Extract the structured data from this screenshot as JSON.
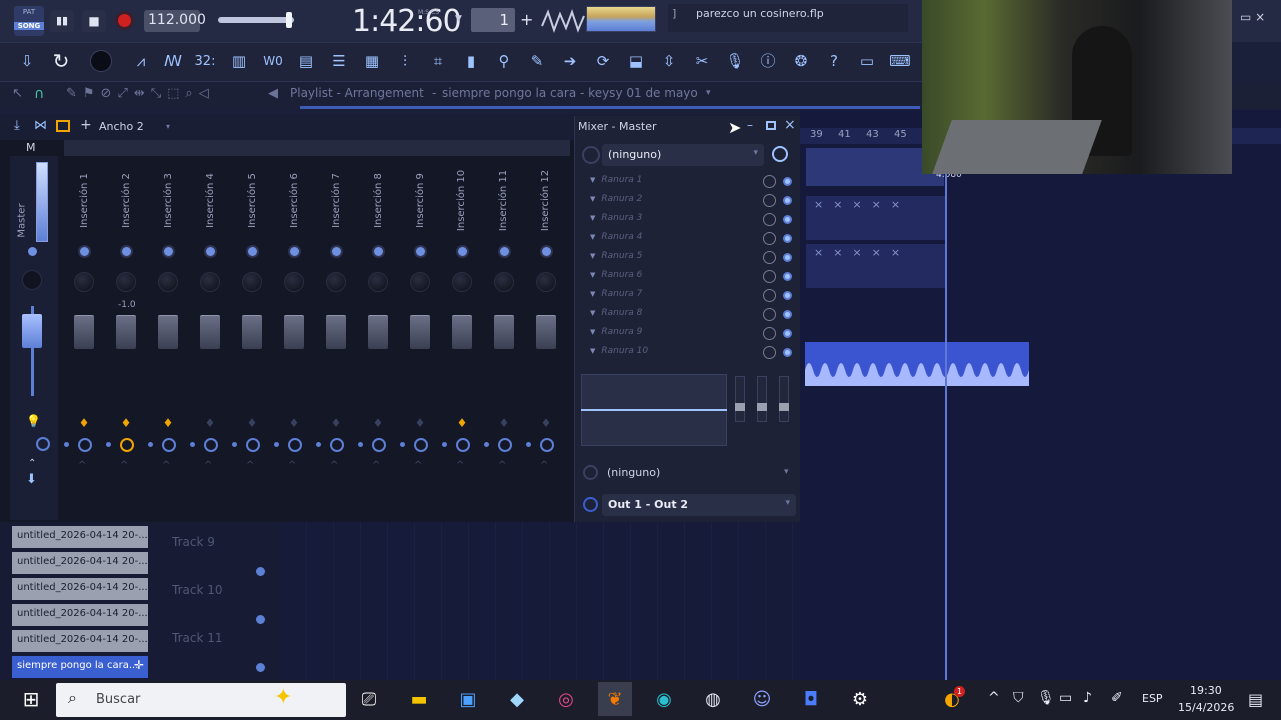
{
  "app": {
    "logo_top": "PAT",
    "logo_bottom": "SONG",
    "tempo": "112.000",
    "time": "1:42:60",
    "time_unit": "M:S:CS",
    "pattern": "1",
    "hint": "parezco un cosinero.flp",
    "colors": {
      "accent": "#5d7fd6",
      "orange": "#f0a500",
      "red": "#d02020"
    }
  },
  "toolbar_icons": [
    "download-icon",
    "refresh-icon",
    "cpu-icon",
    "waveform-icon",
    "tempo-icon",
    "32-icon",
    "grid-icon",
    "mixer-icon",
    "playlist-icon",
    "stack-icon",
    "piano-icon",
    "mixer-sliders-icon",
    "pattern-icon",
    "clipboard-icon",
    "plug-icon",
    "pencil-icon",
    "arrow-icon",
    "loop-icon",
    "save-icon",
    "split-icon",
    "scissors-icon",
    "mic-icon",
    "info-icon",
    "help-icon",
    "question-icon",
    "layout-icon",
    "keyboard-icon"
  ],
  "playlist": {
    "title": "Playlist - Arrangement",
    "subtitle": "siempre pongo la cara - keysy 01 de mayo",
    "ruler": [
      "39",
      "41",
      "43",
      "45"
    ],
    "clip_label": "4.080"
  },
  "mixer_toolbar": {
    "width_label": "Ancho 2"
  },
  "mixer": {
    "title": "Mixer - Master",
    "master_label": "Master",
    "m_label": "M",
    "inserts": [
      "Inserción 1",
      "Inserción 2",
      "Inserción 3",
      "Inserción 4",
      "Inserción 5",
      "Inserción 6",
      "Inserción 7",
      "Inserción 8",
      "Inserción 9",
      "Inserción 10",
      "Inserción 11",
      "Inserción 12"
    ],
    "insert2_value": "-1.0",
    "active_inserts": [
      1,
      2,
      3,
      10
    ]
  },
  "mixer_panel": {
    "preset": "(ninguno)",
    "slots": [
      "Ranura 1",
      "Ranura 2",
      "Ranura 3",
      "Ranura 4",
      "Ranura 5",
      "Ranura 6",
      "Ranura 7",
      "Ranura 8",
      "Ranura 9",
      "Ranura 10"
    ],
    "input": "(ninguno)",
    "output": "Out 1 - Out 2"
  },
  "browser": {
    "files": [
      "untitled_2026-04-14 20-...",
      "untitled_2026-04-14 20-...",
      "untitled_2026-04-14 20-...",
      "untitled_2026-04-14 20-...",
      "untitled_2026-04-14 20-..."
    ],
    "selected_file": "siempre pongo la cara..."
  },
  "tracks": [
    "Track 9",
    "Track 10",
    "Track 11"
  ],
  "taskbar": {
    "search_placeholder": "Buscar",
    "lang": "ESP",
    "time": "19:30",
    "date": "15/4/2026",
    "notif_count": "1"
  }
}
